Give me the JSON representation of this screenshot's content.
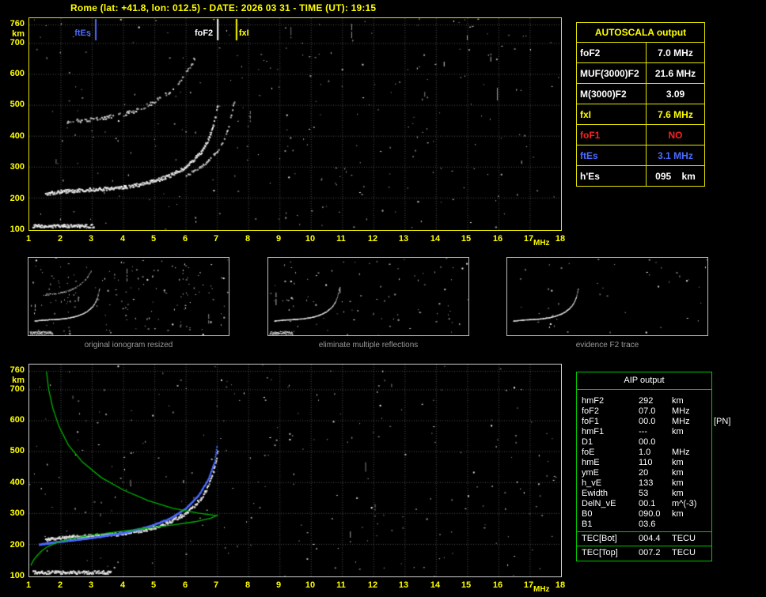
{
  "title": "Rome (lat: +41.8, lon: 012.5) - DATE: 2026 03 31 - TIME (UT): 19:15",
  "colors": {
    "background": "#000000",
    "accent_yellow": "#ffff00",
    "accent_blue": "#4b6bff",
    "accent_red": "#ff2020",
    "accent_green": "#00b400",
    "grid_gray": "#4f4f4f",
    "trace_white": "#ffffff",
    "caption_gray": "#9a9a9a"
  },
  "axes": {
    "x_ticks": [
      "1",
      "2",
      "3",
      "4",
      "5",
      "6",
      "7",
      "8",
      "9",
      "10",
      "11",
      "12",
      "13",
      "14",
      "15",
      "16",
      "17",
      "18"
    ],
    "x_unit": "MHz",
    "y_ticks": [
      "760",
      "700",
      "600",
      "500",
      "400",
      "300",
      "200",
      "100"
    ],
    "y_unit": "km"
  },
  "main_ionogram": {
    "markers": [
      {
        "label": "ftEs",
        "freq": 3.1,
        "color": "#4b6bff"
      },
      {
        "label": "foF2",
        "freq": 7.0,
        "color": "#ffffff"
      },
      {
        "label": "fxI",
        "freq": 7.6,
        "color": "#ffff00"
      }
    ]
  },
  "autoscala_table": {
    "header": "AUTOSCALA output",
    "rows": [
      {
        "label": "foF2",
        "value": "7.0 MHz",
        "color": "#ffffff"
      },
      {
        "label": "MUF(3000)F2",
        "value": "21.6 MHz",
        "color": "#ffffff"
      },
      {
        "label": "M(3000)F2",
        "value": "3.09",
        "color": "#ffffff"
      },
      {
        "label": "fxI",
        "value": "7.6 MHz",
        "color": "#ffff00"
      },
      {
        "label": "foF1",
        "value": "NO",
        "color": "#ff2020"
      },
      {
        "label": "ftEs",
        "value": "3.1 MHz",
        "color": "#4b6bff"
      },
      {
        "label": "h'Es",
        "value": "095    km",
        "color": "#ffffff"
      }
    ]
  },
  "thumbnails": [
    {
      "caption": "original ionogram resized"
    },
    {
      "caption": "eliminate multiple reflections"
    },
    {
      "caption": "evidence F2 trace"
    }
  ],
  "aip_table": {
    "header": "AIP output",
    "rows": [
      {
        "label": "hmF2",
        "value": "292",
        "unit": "km",
        "note": ""
      },
      {
        "label": "foF2",
        "value": "07.0",
        "unit": "MHz",
        "note": ""
      },
      {
        "label": "foF1",
        "value": "00.0",
        "unit": "MHz",
        "note": "[PN]"
      },
      {
        "label": "hmF1",
        "value": "---",
        "unit": "km",
        "note": ""
      },
      {
        "label": "D1",
        "value": "00.0",
        "unit": "",
        "note": ""
      },
      {
        "label": "foE",
        "value": "1.0",
        "unit": "MHz",
        "note": ""
      },
      {
        "label": "hmE",
        "value": "110",
        "unit": "km",
        "note": ""
      },
      {
        "label": "ymE",
        "value": "20",
        "unit": "km",
        "note": ""
      },
      {
        "label": "h_vE",
        "value": "133",
        "unit": "km",
        "note": ""
      },
      {
        "label": "Ewidth",
        "value": "53",
        "unit": "km",
        "note": ""
      },
      {
        "label": "DelN_vE",
        "value": "00.1",
        "unit": "m^(-3)",
        "note": ""
      },
      {
        "label": "B0",
        "value": "090.0",
        "unit": "km",
        "note": ""
      },
      {
        "label": "B1",
        "value": "03.6",
        "unit": "",
        "note": ""
      }
    ],
    "tec_rows": [
      {
        "label": "TEC[Bot]",
        "value": "004.4",
        "unit": "TECU"
      },
      {
        "label": "TEC[Top]",
        "value": "007.2",
        "unit": "TECU"
      }
    ]
  },
  "chart_data": {
    "type": "scatter",
    "x_range": [
      1,
      18
    ],
    "x_label": "MHz",
    "y_range": [
      100,
      760
    ],
    "y_label": "km",
    "f2_trace": [
      [
        1.5,
        215
      ],
      [
        2.0,
        221
      ],
      [
        2.5,
        225
      ],
      [
        3.0,
        228
      ],
      [
        3.5,
        231
      ],
      [
        4.0,
        236
      ],
      [
        4.5,
        244
      ],
      [
        5.0,
        256
      ],
      [
        5.5,
        274
      ],
      [
        5.9,
        296
      ],
      [
        6.2,
        320
      ],
      [
        6.5,
        352
      ],
      [
        6.7,
        388
      ],
      [
        6.85,
        428
      ],
      [
        6.95,
        472
      ],
      [
        7.02,
        510
      ]
    ],
    "es_trace": {
      "height_km": 110,
      "f_start": 1.1,
      "f_end": 3.05
    },
    "restored_trace": [
      [
        1.3,
        200
      ],
      [
        2.0,
        210
      ],
      [
        3.0,
        222
      ],
      [
        4.0,
        238
      ],
      [
        4.8,
        258
      ],
      [
        5.5,
        285
      ],
      [
        6.0,
        318
      ],
      [
        6.4,
        360
      ],
      [
        6.7,
        410
      ],
      [
        6.9,
        465
      ],
      [
        6.98,
        518
      ]
    ],
    "profile_topside": [
      [
        1.55,
        758
      ],
      [
        1.62,
        700
      ],
      [
        1.75,
        640
      ],
      [
        1.95,
        580
      ],
      [
        2.25,
        520
      ],
      [
        2.7,
        465
      ],
      [
        3.3,
        415
      ],
      [
        4.0,
        375
      ],
      [
        4.8,
        340
      ],
      [
        5.6,
        315
      ],
      [
        6.4,
        300
      ],
      [
        6.9,
        293
      ],
      [
        7.0,
        292
      ]
    ],
    "profile_bottomside": [
      [
        7.0,
        292
      ],
      [
        6.8,
        283
      ],
      [
        6.3,
        272
      ],
      [
        5.5,
        260
      ],
      [
        4.6,
        249
      ],
      [
        3.7,
        238
      ],
      [
        2.9,
        227
      ],
      [
        2.3,
        216
      ],
      [
        1.9,
        205
      ],
      [
        1.6,
        192
      ],
      [
        1.4,
        178
      ],
      [
        1.25,
        162
      ],
      [
        1.12,
        145
      ],
      [
        1.05,
        130
      ]
    ]
  }
}
